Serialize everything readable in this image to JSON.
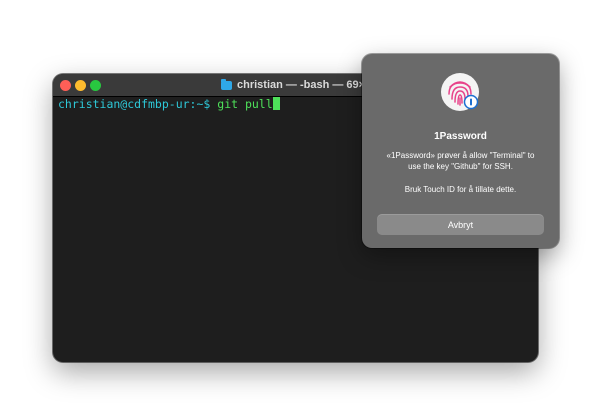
{
  "terminal": {
    "title": "christian — -bash — 69×1",
    "prompt_user": "christian@cdfmbp-ur:~$",
    "command": "git pull",
    "colors": {
      "user": "#2ec8d8",
      "command": "#4ee05a"
    }
  },
  "dialog": {
    "app_name": "1Password",
    "message": "«1Password» prøver å allow \"Terminal\" to\nuse the key \"Github\" for SSH.",
    "hint": "Bruk Touch ID for å tillate dette.",
    "cancel_label": "Avbryt",
    "icon": "touch-id-fingerprint-icon"
  }
}
